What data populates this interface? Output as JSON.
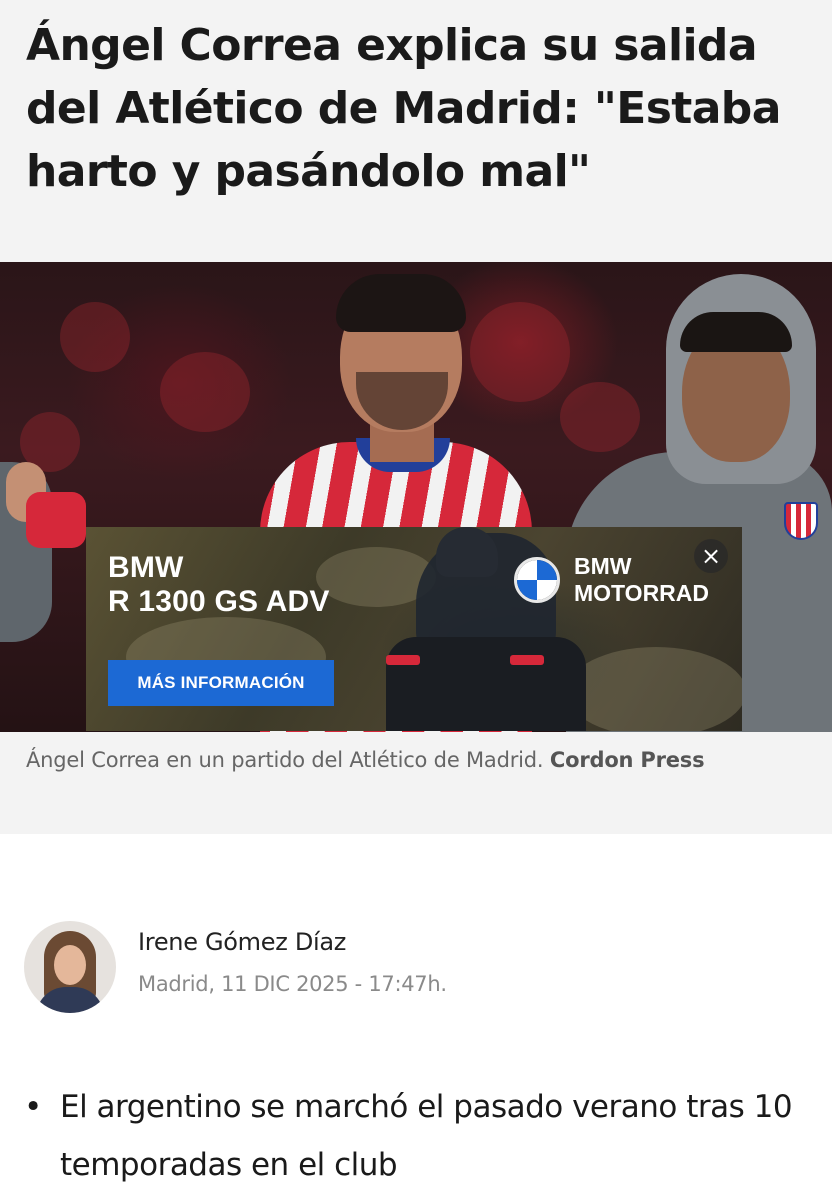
{
  "article": {
    "headline": "Ángel Correa explica su salida del Atlético de Madrid: \"Estaba harto y pasándolo mal\"",
    "caption_text": "Ángel Correa en un partido del Atlético de Madrid.",
    "caption_credit": "Cordon Press",
    "author_name": "Irene Gómez Díaz",
    "author_meta": "Madrid, 11 DIC 2025 - 17:47h.",
    "bullets": [
      "El argentino se marchó el pasado verano tras 10 temporadas en el club"
    ]
  },
  "ad": {
    "model_line1": "BMW",
    "model_line2": "R 1300 GS ADV",
    "brand_line1": "BMW",
    "brand_line2": "MOTORRAD",
    "cta_label": "MÁS INFORMACIÓN",
    "close_icon": "×",
    "cta_color": "#1c69d4"
  },
  "icons": {
    "bullet": "•",
    "ad_close": "close-icon",
    "ad_logo": "bmw-logo-icon"
  }
}
